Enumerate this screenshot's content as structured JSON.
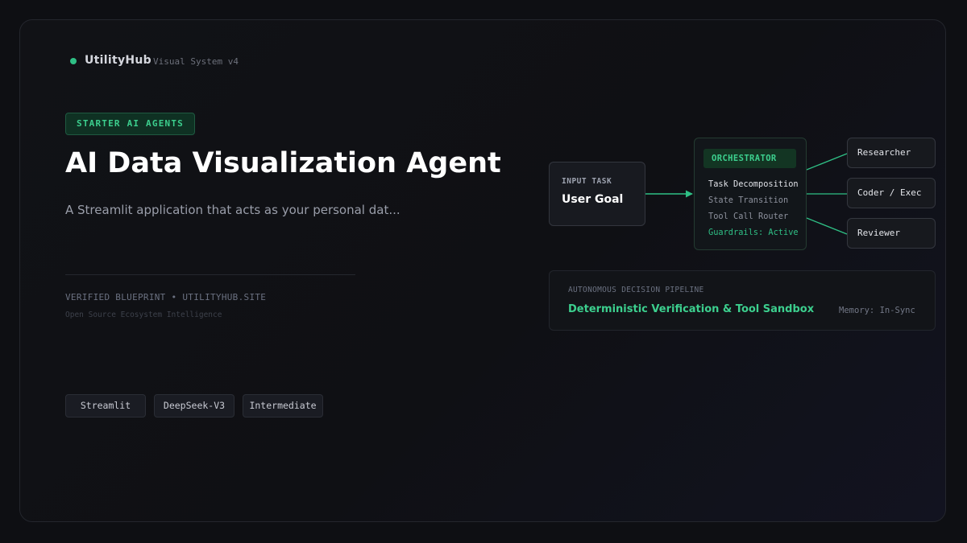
{
  "brand": {
    "name": "UtilityHub",
    "subtitle": "Visual System v4"
  },
  "category_badge": "STARTER AI AGENTS",
  "title": "AI Data Visualization Agent",
  "description": "A Streamlit application that acts as your personal dat...",
  "verified": "VERIFIED BLUEPRINT • UTILITYHUB.SITE",
  "tagline": "Open Source Ecosystem Intelligence",
  "tags": [
    "Streamlit",
    "DeepSeek-V3",
    "Intermediate"
  ],
  "diagram": {
    "input": {
      "label": "INPUT TASK",
      "value": "User Goal"
    },
    "orchestrator": {
      "title": "ORCHESTRATOR",
      "items": [
        "Task Decomposition",
        "State Transition",
        "Tool Call Router",
        "Guardrails: Active"
      ]
    },
    "agents": [
      "Researcher",
      "Coder / Exec",
      "Reviewer"
    ],
    "pipeline": {
      "label": "AUTONOMOUS DECISION PIPELINE",
      "title": "Deterministic Verification & Tool Sandbox",
      "memory": "Memory: In-Sync"
    }
  },
  "colors": {
    "accent": "#3ccf8e",
    "background": "#0e0f13"
  }
}
